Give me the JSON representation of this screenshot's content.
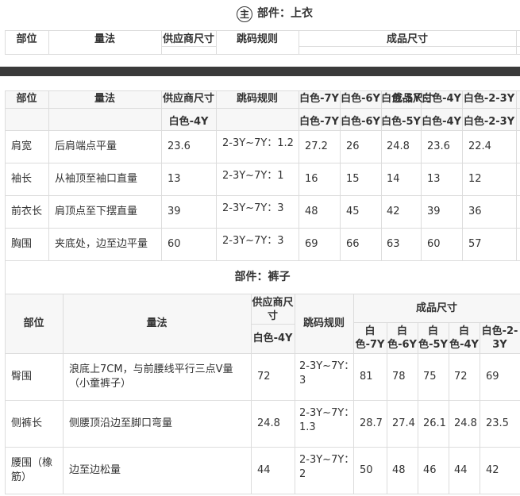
{
  "section1": {
    "badge": "主",
    "title": "部件：上衣",
    "headers": {
      "part": "部位",
      "method": "量法",
      "supplier": "供应商尺寸",
      "jump": "跳码规则",
      "finished": "成品尺寸"
    }
  },
  "table2": {
    "headers": {
      "part": "部位",
      "method": "量法",
      "supplier": "供应商尺寸",
      "jump": "跳码规则",
      "finished": "成品尺寸"
    },
    "top_sizes": [
      "白色-7Y",
      "白色-6Y",
      "白色-5Y",
      "白色-4Y",
      "白色-2-3Y"
    ],
    "supplier_size": "白色-4Y",
    "sizes": [
      "白色-7Y",
      "白色-6Y",
      "白色-5Y",
      "白色-4Y",
      "白色-2-3Y"
    ],
    "rows": [
      {
        "part": "肩宽",
        "method": "后肩端点平量",
        "supplier": "23.6",
        "jump": "2-3Y~7Y：1.2",
        "values": [
          "27.2",
          "26",
          "24.8",
          "23.6",
          "22.4"
        ]
      },
      {
        "part": "袖长",
        "method": "从袖顶至袖口直量",
        "supplier": "13",
        "jump": "2-3Y~7Y：1",
        "values": [
          "16",
          "15",
          "14",
          "13",
          "12"
        ]
      },
      {
        "part": "前衣长",
        "method": "肩顶点至下摆直量",
        "supplier": "39",
        "jump": "2-3Y~7Y：3",
        "values": [
          "48",
          "45",
          "42",
          "39",
          "36"
        ]
      },
      {
        "part": "胸围",
        "method": "夹底处，边至边平量",
        "supplier": "60",
        "jump": "2-3Y~7Y：3",
        "values": [
          "69",
          "66",
          "63",
          "60",
          "57"
        ]
      }
    ]
  },
  "section3": {
    "title": "部件：裤子",
    "headers": {
      "part": "部位",
      "method": "量法",
      "supplier_l1": "供应商尺",
      "supplier_l2": "寸",
      "jump": "跳码规则",
      "finished": "成品尺寸"
    },
    "supplier_size": "白色-4Y",
    "sizes": [
      {
        "l1": "白",
        "l2": "色-7Y"
      },
      {
        "l1": "白",
        "l2": "色-6Y"
      },
      {
        "l1": "白",
        "l2": "色-5Y"
      },
      {
        "l1": "白",
        "l2": "色-4Y"
      },
      {
        "l1": "白色-2-",
        "l2": "3Y"
      }
    ],
    "rows": [
      {
        "part_l1": "臀围",
        "part_l2": "",
        "method_l1": "浪底上7CM，与前腰线平行三点V量",
        "method_l2": "（小童裤子）",
        "supplier": "72",
        "jump_l1": "2-3Y~7Y：",
        "jump_l2": "3",
        "values": [
          "81",
          "78",
          "75",
          "72",
          "69"
        ]
      },
      {
        "part_l1": "侧裤长",
        "part_l2": "",
        "method_l1": "侧腰顶沿边至脚口弯量",
        "method_l2": "",
        "supplier": "24.8",
        "jump_l1": "2-3Y~7Y：",
        "jump_l2": "1.3",
        "values": [
          "28.7",
          "27.4",
          "26.1",
          "24.8",
          "23.5"
        ]
      },
      {
        "part_l1": "腰围（橡",
        "part_l2": "筋）",
        "method_l1": "边至边松量",
        "method_l2": "",
        "supplier": "44",
        "jump_l1": "2-3Y~7Y：",
        "jump_l2": "2",
        "values": [
          "50",
          "48",
          "46",
          "44",
          "42"
        ]
      }
    ]
  }
}
